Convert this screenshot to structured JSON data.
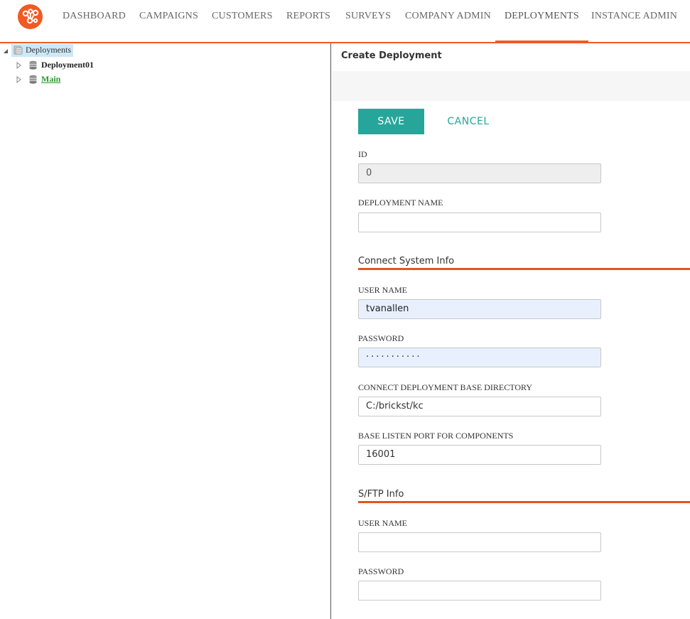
{
  "nav": {
    "items": [
      {
        "label": "DASHBOARD"
      },
      {
        "label": "CAMPAIGNS"
      },
      {
        "label": "CUSTOMERS"
      },
      {
        "label": "REPORTS"
      },
      {
        "label": "SURVEYS"
      },
      {
        "label": "COMPANY ADMIN"
      },
      {
        "label": "DEPLOYMENTS",
        "active": true
      },
      {
        "label": "INSTANCE ADMIN"
      }
    ],
    "accent_color": "#f15a22"
  },
  "tree": {
    "root": {
      "label": "Deployments",
      "icon": "database-stack-icon"
    },
    "children": [
      {
        "label": "Deployment01",
        "icon": "database-icon"
      },
      {
        "label": "Main",
        "icon": "database-icon"
      }
    ]
  },
  "form": {
    "title": "Create Deployment",
    "save_label": "SAVE",
    "cancel_label": "CANCEL",
    "button_color": "#26a69a",
    "id": {
      "label": "ID",
      "value": "0"
    },
    "deployment_name": {
      "label": "DEPLOYMENT NAME",
      "value": ""
    },
    "connect_section": {
      "title": "Connect System Info",
      "user_name": {
        "label": "USER NAME",
        "value": "tvanallen"
      },
      "password": {
        "label": "PASSWORD",
        "value": "···········"
      },
      "base_directory": {
        "label": "CONNECT DEPLOYMENT BASE DIRECTORY",
        "value": "C:/brickst/kc"
      },
      "base_port": {
        "label": "BASE LISTEN PORT FOR COMPONENTS",
        "value": "16001"
      }
    },
    "sftp_section": {
      "title": "S/FTP Info",
      "user_name": {
        "label": "USER NAME",
        "value": ""
      },
      "password": {
        "label": "PASSWORD",
        "value": ""
      }
    },
    "section_color": "#e8541b"
  }
}
